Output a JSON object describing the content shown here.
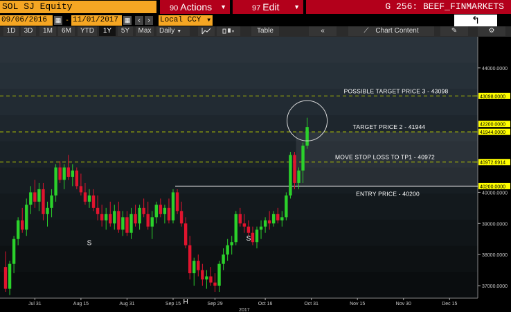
{
  "header": {
    "ticker": "SOL SJ Equity",
    "actions_num": "90",
    "actions_label": "Actions",
    "edit_num": "97",
    "edit_label": "Edit",
    "title": "G 256: BEEF_FINMARKETS"
  },
  "range": {
    "start_date": "09/06/2016",
    "end_date": "11/01/2017",
    "currency": "Local CCY"
  },
  "toolbar": {
    "periods": [
      "1D",
      "3D",
      "1M",
      "6M",
      "YTD",
      "1Y",
      "5Y",
      "Max"
    ],
    "active_period": "1Y",
    "frequency": "Daily",
    "table_label": "Table",
    "chart_content_label": "Chart Content"
  },
  "chart_data": {
    "type": "candlestick",
    "ylim": [
      36600,
      45000
    ],
    "y_ticks": [
      {
        "value": 44000,
        "label": "44000.0000"
      },
      {
        "value": 40000,
        "label": "40000.0000"
      },
      {
        "value": 39000,
        "label": "39000.0000"
      },
      {
        "value": 38000,
        "label": "38000.0000"
      },
      {
        "value": 37000,
        "label": "37000.0000"
      }
    ],
    "x_ticks": [
      {
        "label": "Jul 31",
        "i": 7
      },
      {
        "label": "Aug 15",
        "i": 18
      },
      {
        "label": "Aug 31",
        "i": 29
      },
      {
        "label": "Sep 15",
        "i": 40
      },
      {
        "label": "Sep 29",
        "i": 50
      },
      {
        "label": "Oct 16",
        "i": 62
      },
      {
        "label": "Oct 31",
        "i": 73
      },
      {
        "label": "Nov 15",
        "i": 84
      },
      {
        "label": "Nov 30",
        "i": 95
      },
      {
        "label": "Dec 15",
        "i": 106
      }
    ],
    "year_label": "2017",
    "year_label_i": 57,
    "candles": [
      [
        37600,
        38100,
        36800,
        36900
      ],
      [
        36900,
        37800,
        36700,
        37700
      ],
      [
        37700,
        38600,
        37400,
        38500
      ],
      [
        38500,
        39200,
        38300,
        39100
      ],
      [
        39100,
        39500,
        38700,
        38800
      ],
      [
        38800,
        39800,
        38600,
        39600
      ],
      [
        39600,
        40200,
        39300,
        40000
      ],
      [
        40000,
        40400,
        39500,
        39700
      ],
      [
        39700,
        40300,
        39400,
        40100
      ],
      [
        40100,
        40300,
        39100,
        39300
      ],
      [
        39300,
        39700,
        38900,
        39500
      ],
      [
        39500,
        40100,
        39200,
        39900
      ],
      [
        39900,
        40900,
        39700,
        40800
      ],
      [
        40800,
        41000,
        40300,
        40400
      ],
      [
        40400,
        40900,
        40100,
        40800
      ],
      [
        40800,
        41200,
        40400,
        40500
      ],
      [
        40500,
        40900,
        40200,
        40700
      ],
      [
        40700,
        40800,
        40100,
        40200
      ],
      [
        40200,
        40600,
        39900,
        40000
      ],
      [
        40000,
        40300,
        39600,
        39700
      ],
      [
        39700,
        40100,
        39500,
        39900
      ],
      [
        39900,
        40100,
        39400,
        39500
      ],
      [
        39500,
        39900,
        39100,
        39300
      ],
      [
        39300,
        39600,
        38900,
        39100
      ],
      [
        39100,
        39500,
        38800,
        39300
      ],
      [
        39300,
        39700,
        38900,
        39000
      ],
      [
        39000,
        39600,
        38800,
        39400
      ],
      [
        39400,
        39700,
        38700,
        38800
      ],
      [
        38800,
        39400,
        38600,
        39200
      ],
      [
        39200,
        39400,
        38600,
        38700
      ],
      [
        38700,
        39500,
        38500,
        39300
      ],
      [
        39300,
        39600,
        38900,
        39000
      ],
      [
        39000,
        39600,
        38800,
        39500
      ],
      [
        39500,
        39800,
        39200,
        39300
      ],
      [
        39300,
        39700,
        38800,
        38900
      ],
      [
        38900,
        39400,
        38500,
        39200
      ],
      [
        39200,
        39700,
        39000,
        39600
      ],
      [
        39600,
        39800,
        39200,
        39300
      ],
      [
        39300,
        39600,
        39000,
        39500
      ],
      [
        39500,
        39800,
        39000,
        39100
      ],
      [
        39100,
        40100,
        39000,
        40000
      ],
      [
        40000,
        40100,
        39300,
        39400
      ],
      [
        39400,
        39700,
        38900,
        39000
      ],
      [
        39000,
        39200,
        38200,
        38300
      ],
      [
        38300,
        38600,
        37200,
        37400
      ],
      [
        37400,
        37900,
        37000,
        37800
      ],
      [
        37800,
        38000,
        37300,
        37500
      ],
      [
        37500,
        37700,
        37000,
        37200
      ],
      [
        37200,
        37500,
        36900,
        37300
      ],
      [
        37300,
        37600,
        37000,
        37100
      ],
      [
        37100,
        37400,
        36800,
        37000
      ],
      [
        37000,
        37800,
        36800,
        37700
      ],
      [
        37700,
        38200,
        37500,
        38000
      ],
      [
        38000,
        38500,
        37800,
        38300
      ],
      [
        38300,
        38600,
        38000,
        38400
      ],
      [
        38400,
        39400,
        38300,
        39300
      ],
      [
        39300,
        39500,
        38900,
        39000
      ],
      [
        39000,
        39300,
        38700,
        38900
      ],
      [
        38900,
        39100,
        38600,
        38700
      ],
      [
        38700,
        38900,
        38300,
        38400
      ],
      [
        38400,
        38900,
        38200,
        38800
      ],
      [
        38800,
        39100,
        38500,
        38900
      ],
      [
        38900,
        39200,
        38700,
        39100
      ],
      [
        39100,
        39400,
        38800,
        39000
      ],
      [
        39000,
        39400,
        38900,
        39300
      ],
      [
        39300,
        39500,
        39000,
        39100
      ],
      [
        39100,
        39400,
        38900,
        39200
      ],
      [
        39200,
        40000,
        39100,
        39900
      ],
      [
        39900,
        41300,
        39800,
        41200
      ],
      [
        41200,
        41300,
        40100,
        40300
      ],
      [
        40300,
        40800,
        40100,
        40700
      ],
      [
        40700,
        41600,
        40300,
        41500
      ],
      [
        41500,
        42400,
        41400,
        42100
      ]
    ],
    "levels": [
      {
        "price": 43098,
        "label": "POSSIBLE TARGET PRICE 3 - 43098",
        "style": "dashed",
        "tag": "43098.0000"
      },
      {
        "price": 42200,
        "label": "",
        "style": "none",
        "tag": "42200.0000"
      },
      {
        "price": 41944,
        "label": "TARGET PRICE 2 - 41944",
        "style": "dashed",
        "tag": "41944.0000"
      },
      {
        "price": 40972.6914,
        "label": "MOVE STOP LOSS TO TP1 - 40972",
        "style": "dashed",
        "tag": "40972.6914"
      },
      {
        "price": 40200,
        "label": "ENTRY PRICE - 40200",
        "style": "solid",
        "tag": "40200.0000"
      }
    ],
    "annotations": [
      {
        "text": "S",
        "i": 20,
        "price": 38300
      },
      {
        "text": "S",
        "i": 58,
        "price": 38450
      },
      {
        "text": "H",
        "i": 43,
        "price": 36420
      }
    ],
    "colors": {
      "up": "#2bd12b",
      "down": "#e0142e",
      "level_dashed": "#b5c800",
      "level_solid": "#ffffff",
      "tag_fill": "#ffff00",
      "tag_text": "#000000"
    }
  }
}
